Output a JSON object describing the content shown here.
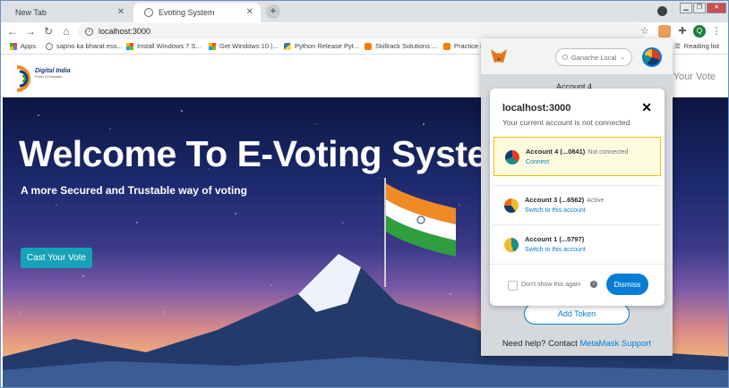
{
  "browser": {
    "tabs": [
      {
        "title": "New Tab",
        "active": false
      },
      {
        "title": "Evoting System",
        "active": true
      }
    ],
    "url": "localhost:3000",
    "profile_initial": "Q",
    "bookmarks": [
      {
        "label": "Apps",
        "icon": "apps-grid-icon"
      },
      {
        "label": "sapno ka bharat ess...",
        "icon": "globe-icon"
      },
      {
        "label": "Install Windows 7 S...",
        "icon": "microsoft-icon"
      },
      {
        "label": "Get Windows 10 |...",
        "icon": "microsoft-icon"
      },
      {
        "label": "Python Release Pyt...",
        "icon": "python-icon"
      },
      {
        "label": "Skillrack Solutions:...",
        "icon": "blogger-icon"
      },
      {
        "label": "Practice Pr",
        "icon": "blogger-icon"
      }
    ],
    "reading_list": "Reading list"
  },
  "site": {
    "logo_text": "Digital India",
    "logo_tagline": "Power To Empower",
    "nav_link": "t Your Vote",
    "hero_title": "Welcome To E-Voting Syste",
    "hero_subtitle": "A more Secured and Trustable way of voting",
    "cta": "Cast Your Vote"
  },
  "metamask": {
    "network": "Ganache Local",
    "behind_account": "Account 4",
    "add_token": "Add Token",
    "help_prefix": "Need help? Contact ",
    "help_link": "MetaMask Support",
    "popup": {
      "title": "localhost:3000",
      "description": "Your current account is not connected",
      "accounts": [
        {
          "name": "Account 4 (...0841)",
          "status": "Not connected",
          "action": "Connect",
          "selected": true
        },
        {
          "name": "Account 3 (...6562)",
          "status": "Active",
          "action": "Switch to this account",
          "selected": false
        },
        {
          "name": "Account 1 (...5797)",
          "status": "",
          "action": "Switch to this account",
          "selected": false
        }
      ],
      "dont_show": "Don't show this again",
      "dismiss": "Dismiss"
    }
  },
  "colors": {
    "accent": "#037dd6",
    "cta": "#17a2b8",
    "selected_bg": "#fefcde"
  }
}
